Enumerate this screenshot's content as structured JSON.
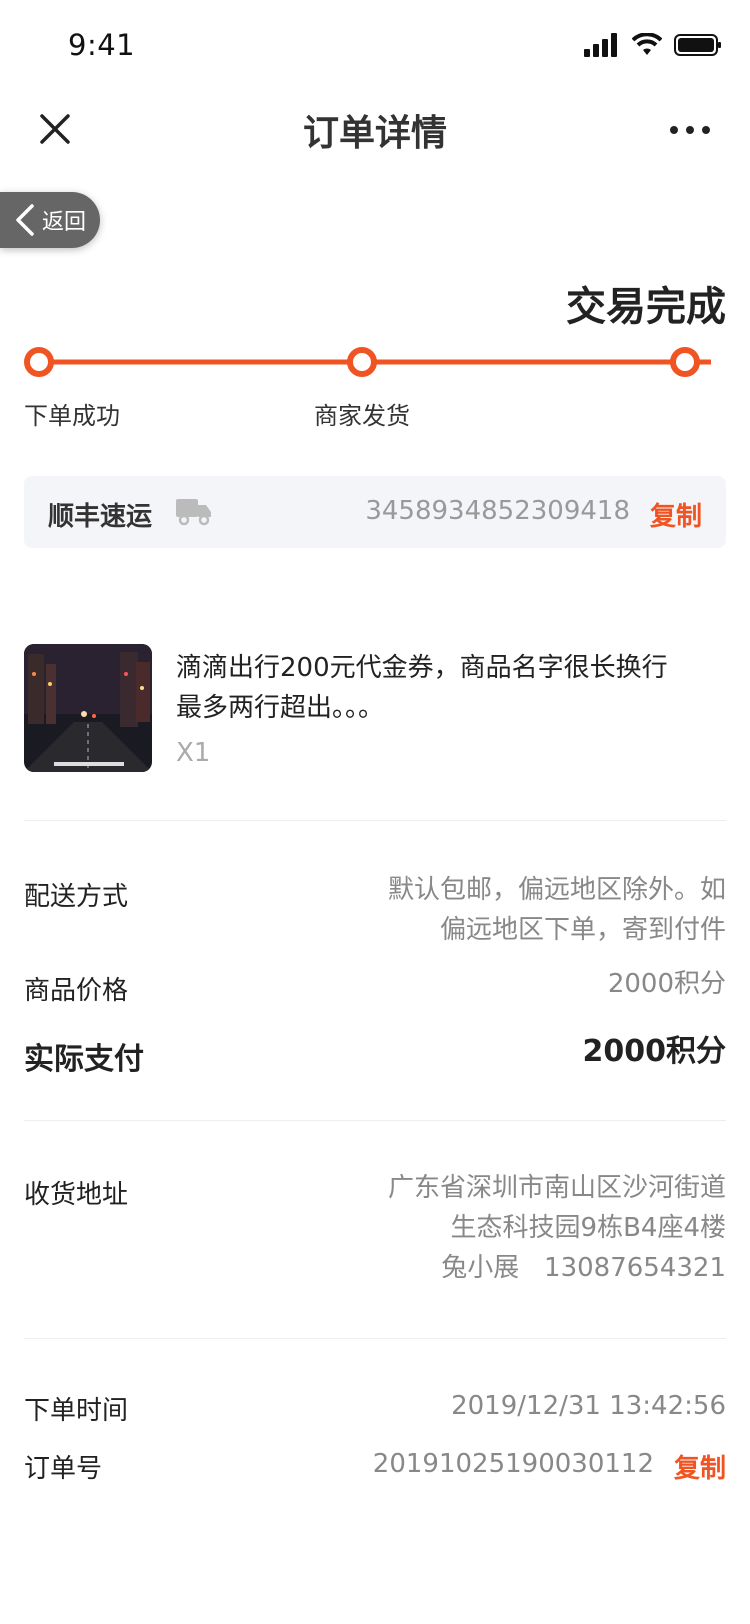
{
  "status_bar": {
    "time": "9:41"
  },
  "nav": {
    "title": "订单详情",
    "back_label": "返回"
  },
  "order": {
    "status": "交易完成",
    "steps": [
      "下单成功",
      "商家发货"
    ]
  },
  "logistics": {
    "carrier": "顺丰速运",
    "tracking_number": "3458934852309418",
    "copy_label": "复制"
  },
  "product": {
    "name_line1": "滴滴出行200元代金券，商品名字很长换行",
    "name_line2": "最多两行超出。。。",
    "quantity": "X1"
  },
  "details": {
    "shipping_label": "配送方式",
    "shipping_line1": "默认包邮，偏远地区除外。如",
    "shipping_line2": "偏远地区下单，寄到付件",
    "price_label": "商品价格",
    "price_value": "2000积分",
    "paid_label": "实际支付",
    "paid_value": "2000积分"
  },
  "address": {
    "label": "收货地址",
    "line1": "广东省深圳市南山区沙河街道",
    "line2": "生态科技园9栋B4座4楼",
    "line3": "兔小展   13087654321"
  },
  "meta": {
    "time_label": "下单时间",
    "time_value": "2019/12/31 13:42:56",
    "order_no_label": "订单号",
    "order_no_value": "20191025190030112",
    "copy_label": "复制"
  },
  "colors": {
    "accent": "#f05422"
  }
}
